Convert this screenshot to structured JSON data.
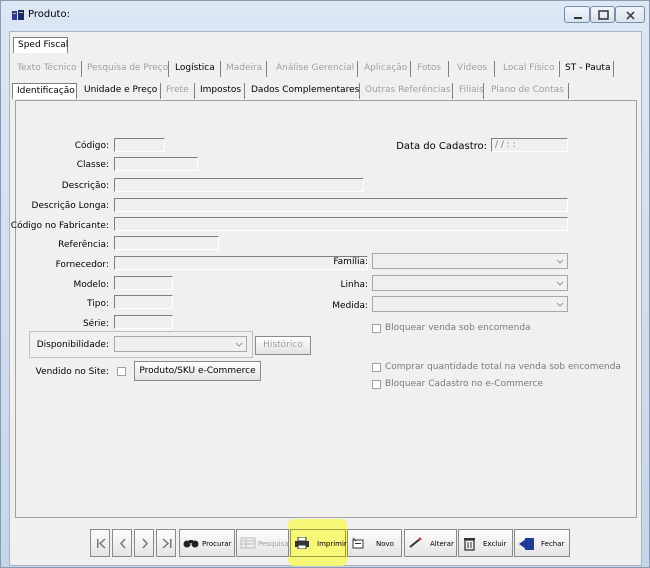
{
  "window": {
    "title": "Produto:",
    "minimize_icon": "minimize-icon",
    "maximize_icon": "maximize-icon",
    "close_icon": "close-icon"
  },
  "tabs_row1": [
    "Sped Fiscal"
  ],
  "tabs_row2": [
    {
      "label": "Texto Técnico",
      "enabled": false
    },
    {
      "label": "Pesquisa de Preço",
      "enabled": false
    },
    {
      "label": "Logística",
      "enabled": true
    },
    {
      "label": "Madeira",
      "enabled": false
    },
    {
      "label": "Análise Gerencial",
      "enabled": false
    },
    {
      "label": "Aplicação",
      "enabled": false
    },
    {
      "label": "Fotos",
      "enabled": false
    },
    {
      "label": "Vídeos",
      "enabled": false
    },
    {
      "label": "Local Físico",
      "enabled": false
    },
    {
      "label": "ST - Pauta",
      "enabled": true
    }
  ],
  "tabs_row3": [
    {
      "label": "Identificação",
      "enabled": true,
      "active": true
    },
    {
      "label": "Unidade e Preço",
      "enabled": true
    },
    {
      "label": "Frete",
      "enabled": false
    },
    {
      "label": "Impostos",
      "enabled": true
    },
    {
      "label": "Dados Complementares",
      "enabled": true
    },
    {
      "label": "Outras Referências",
      "enabled": false
    },
    {
      "label": "Filiais",
      "enabled": false
    },
    {
      "label": "Plano de Contas",
      "enabled": false
    }
  ],
  "form": {
    "codigo_label": "Código:",
    "classe_label": "Classe:",
    "descricao_label": "Descrição:",
    "descricao_longa_label": "Descrição Longa:",
    "codigo_fabricante_label": "Código no Fabricante:",
    "referencia_label": "Referência:",
    "fornecedor_label": "Fornecedor:",
    "modelo_label": "Modelo:",
    "tipo_label": "Tipo:",
    "serie_label": "Série:",
    "disponibilidade_label": "Disponibilidade:",
    "vendido_site_label": "Vendido no Site:",
    "data_cadastro_label": "Data do Cadastro:",
    "data_cadastro_value": "/ /      : :",
    "familia_label": "Família:",
    "linha_label": "Linha:",
    "medida_label": "Medida:",
    "historico_button": "Histórico",
    "produto_sku_button": "Produto/SKU e-Commerce",
    "bloquear_venda_label": "Bloquear venda sob encomenda",
    "comprar_quantidade_label": "Comprar quantidade total na venda sob encomenda",
    "bloquear_cadastro_label": "Bloquear Cadastro no e-Commerce"
  },
  "toolbar": {
    "procurar": "Procurar",
    "pesquisa": "Pesquisa",
    "imprimir": "Imprimir",
    "novo": "Novo",
    "alterar": "Alterar",
    "excluir": "Excluir",
    "fechar": "Fechar"
  },
  "colors": {
    "highlight": "#f7f76a",
    "disabled_text": "#a0a0a0"
  }
}
